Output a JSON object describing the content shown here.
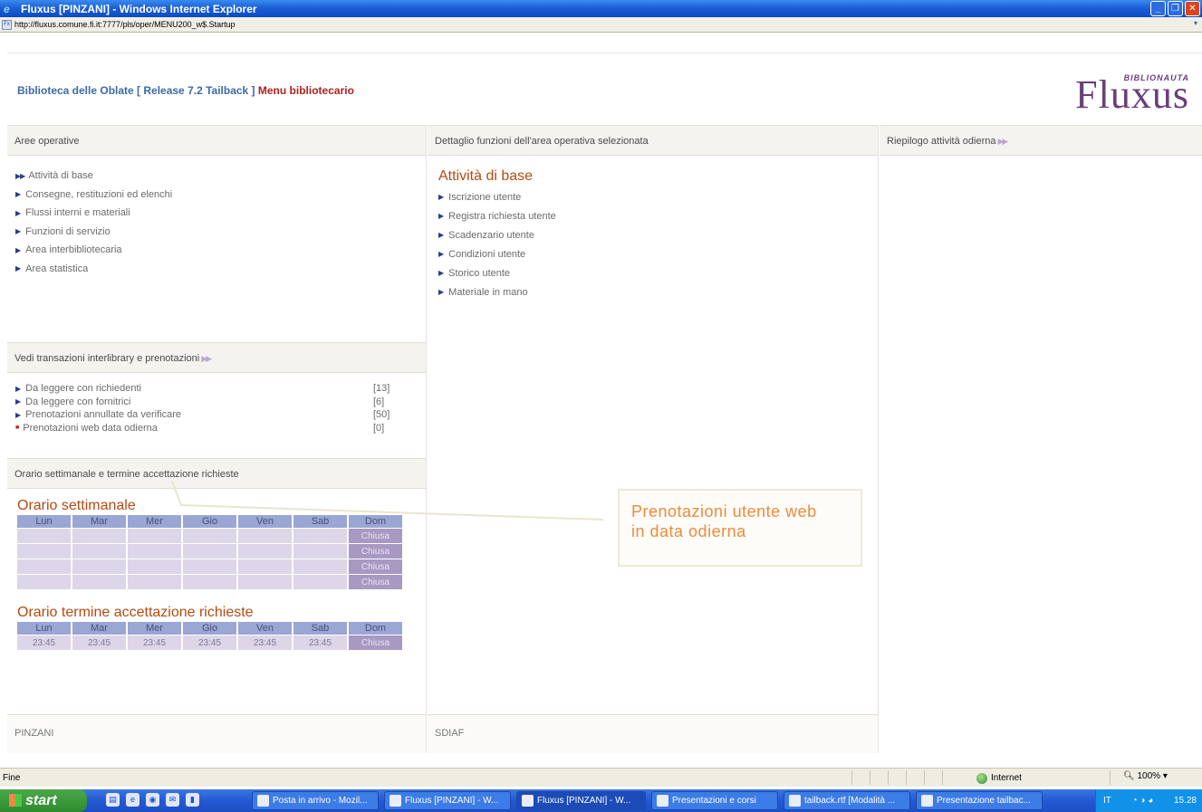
{
  "window": {
    "title": "Fluxus [PINZANI] - Windows Internet Explorer",
    "url": "http://fluxus.comune.fi.it:7777/pls/oper/MENU200_w$.Startup"
  },
  "header": {
    "library": "Biblioteca delle Oblate [ Release 7.2 Tailback ]",
    "menu_label": "Menu bibliotecario",
    "logo": "Fluxus",
    "logo_sub": "BIBLIONAUTA"
  },
  "left": {
    "areas_head": "Aree operative",
    "areas": [
      "Attività di base",
      "Consegne, restituzioni ed elenchi",
      "Flussi interni e materiali",
      "Funzioni di servizio",
      "Area interbibliotecaria",
      "Area statistica"
    ],
    "transactions_head": "Vedi transazioni interlibrary e prenotazioni",
    "transactions": [
      {
        "label": "Da leggere con richiedenti",
        "count": "[13]"
      },
      {
        "label": "Da leggere con fornitrici",
        "count": "[6]"
      },
      {
        "label": "Prenotazioni annullate da verificare",
        "count": "[50]"
      },
      {
        "label": "Prenotazioni web data odierna",
        "count": "[0]"
      }
    ],
    "hours_head": "Orario settimanale e termine accettazione richieste",
    "weekly_title": "Orario settimanale",
    "days": [
      "Lun",
      "Mar",
      "Mer",
      "Gio",
      "Ven",
      "Sab",
      "Dom"
    ],
    "closed_label": "Chiusa",
    "deadline_title": "Orario termine accettazione richieste",
    "deadline_time": "23:45",
    "footer": "PINZANI"
  },
  "middle": {
    "head": "Dettaglio funzioni dell'area operativa selezionata",
    "title": "Attività di base",
    "items": [
      "Iscrizione utente",
      "Registra richiesta utente",
      "Scadenzario utente",
      "Condizioni utente",
      "Storico utente",
      "Materiale in mano"
    ],
    "footer": "SDIAF"
  },
  "right": {
    "head": "Riepilogo attività odierna"
  },
  "callout": {
    "line1": "Prenotazioni utente web",
    "line2": "in data odierna"
  },
  "statusbar": {
    "status": "Fine",
    "zone": "Internet",
    "zoom": "100%"
  },
  "taskbar": {
    "start": "start",
    "tasks": [
      "Posta in arrivo - Mozil...",
      "Fluxus [PINZANI] - W...",
      "Fluxus [PINZANI] - W...",
      "Presentazioni e corsi",
      "tailback.rtf [Modalità ...",
      "Presentazione tailbac..."
    ],
    "lang": "IT",
    "clock": "15.28"
  },
  "colors": {
    "title_red": "#b44a10",
    "menu_red": "#b02020",
    "link_blue": "#3d6aa8",
    "logo_purple": "#6b3f7a",
    "callout_orange": "#f08a3a"
  }
}
